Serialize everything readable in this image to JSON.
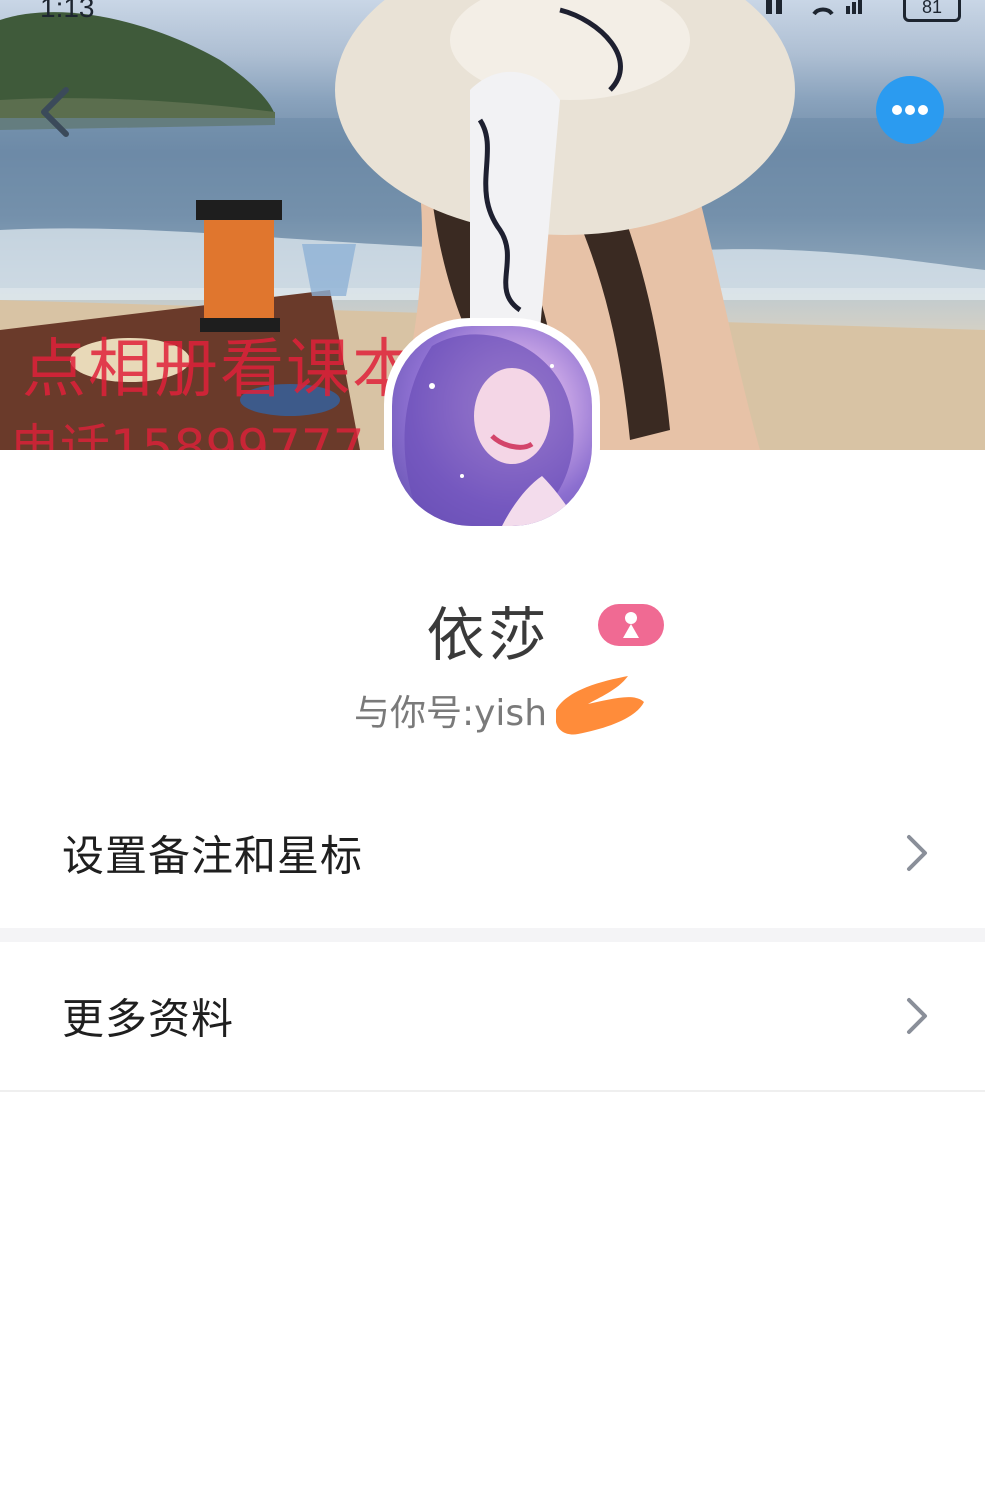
{
  "status_bar": {
    "time": "1:13",
    "battery": "81"
  },
  "cover": {
    "watermark_line1": "点相册看课本",
    "watermark_line2": "电话15899777"
  },
  "navigation": {
    "back_icon": "chevron-left-icon",
    "more_icon": "ellipsis-icon"
  },
  "profile": {
    "name": "依莎",
    "gender_icon": "female-icon",
    "account_label": "与你号:yish"
  },
  "menu": {
    "items": [
      {
        "label": "设置备注和星标",
        "icon": "chevron-right-icon"
      },
      {
        "label": "更多资料",
        "icon": "chevron-right-icon"
      }
    ]
  },
  "colors": {
    "accent": "#2b9bf0",
    "gender_badge": "#f06a93",
    "watermark": "#e0213a",
    "redaction": "#ff8c3a"
  }
}
